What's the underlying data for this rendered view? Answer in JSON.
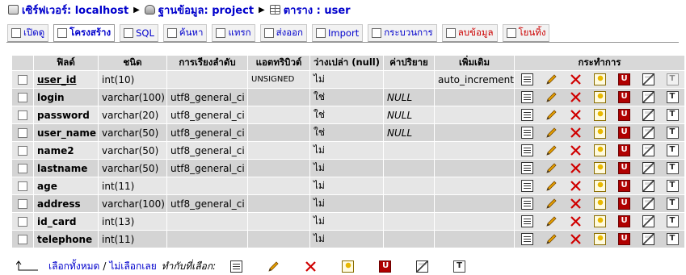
{
  "breadcrumb": {
    "server": "เซิร์ฟเวอร์: localhost",
    "database": "ฐานข้อมูล: project",
    "table": "ตาราง : user"
  },
  "tabs": [
    {
      "label": "เปิดดู",
      "icon": "browse-icon"
    },
    {
      "label": "โครงสร้าง",
      "icon": "structure-icon",
      "active": true
    },
    {
      "label": "SQL",
      "icon": "sql-icon"
    },
    {
      "label": "ค้นหา",
      "icon": "search-icon"
    },
    {
      "label": "แทรก",
      "icon": "insert-icon"
    },
    {
      "label": "ส่งออก",
      "icon": "export-icon"
    },
    {
      "label": "Import",
      "icon": "import-icon"
    },
    {
      "label": "กระบวนการ",
      "icon": "operations-icon"
    },
    {
      "label": "ลบข้อมูล",
      "icon": "empty-icon",
      "danger": true
    },
    {
      "label": "โยนทิ้ง",
      "icon": "drop-table-icon",
      "danger": true
    }
  ],
  "table": {
    "headers": {
      "field": "ฟิลด์",
      "type": "ชนิด",
      "collation": "การเรียงลำดับ",
      "attributes": "แอตทริบิวต์",
      "null": "ว่างเปล่า (null)",
      "default": "ค่าปริยาย",
      "extra": "เพิ่มเติม",
      "action": "กระทำการ"
    },
    "rows": [
      {
        "field": "user_id",
        "type": "int(10)",
        "collation": "",
        "attributes": "UNSIGNED",
        "null": "ไม่",
        "default": "",
        "extra": "auto_increment",
        "primary": true
      },
      {
        "field": "login",
        "type": "varchar(100)",
        "collation": "utf8_general_ci",
        "attributes": "",
        "null": "ใช่",
        "default": "NULL",
        "extra": ""
      },
      {
        "field": "password",
        "type": "varchar(20)",
        "collation": "utf8_general_ci",
        "attributes": "",
        "null": "ใช่",
        "default": "NULL",
        "extra": ""
      },
      {
        "field": "user_name",
        "type": "varchar(50)",
        "collation": "utf8_general_ci",
        "attributes": "",
        "null": "ใช่",
        "default": "NULL",
        "extra": ""
      },
      {
        "field": "name2",
        "type": "varchar(50)",
        "collation": "utf8_general_ci",
        "attributes": "",
        "null": "ไม่",
        "default": "",
        "extra": ""
      },
      {
        "field": "lastname",
        "type": "varchar(50)",
        "collation": "utf8_general_ci",
        "attributes": "",
        "null": "ไม่",
        "default": "",
        "extra": ""
      },
      {
        "field": "age",
        "type": "int(11)",
        "collation": "",
        "attributes": "",
        "null": "ไม่",
        "default": "",
        "extra": ""
      },
      {
        "field": "address",
        "type": "varchar(100)",
        "collation": "utf8_general_ci",
        "attributes": "",
        "null": "ไม่",
        "default": "",
        "extra": ""
      },
      {
        "field": "id_card",
        "type": "int(13)",
        "collation": "",
        "attributes": "",
        "null": "ไม่",
        "default": "",
        "extra": ""
      },
      {
        "field": "telephone",
        "type": "int(11)",
        "collation": "",
        "attributes": "",
        "null": "ไม่",
        "default": "",
        "extra": ""
      }
    ]
  },
  "row_actions": [
    "browse-icon",
    "edit-pencil-icon",
    "drop-x-icon",
    "primary-key-icon",
    "unique-icon",
    "index-icon",
    "fulltext-icon"
  ],
  "bottom": {
    "check_all": "เลือกทั้งหมด",
    "separator": "/",
    "uncheck_all": "ไม่เลือกเลย",
    "with_selected": "ทำกับที่เลือก:",
    "actions": [
      "browse-icon",
      "edit-pencil-icon",
      "drop-x-icon",
      "primary-key-icon",
      "unique-icon",
      "index-icon",
      "fulltext-icon"
    ]
  },
  "colors": {
    "link": "#0000cc",
    "danger": "#cc0000",
    "header_bg": "#d8d8d8",
    "row_odd": "#e6e6e6",
    "row_even": "#d4d4d4"
  }
}
